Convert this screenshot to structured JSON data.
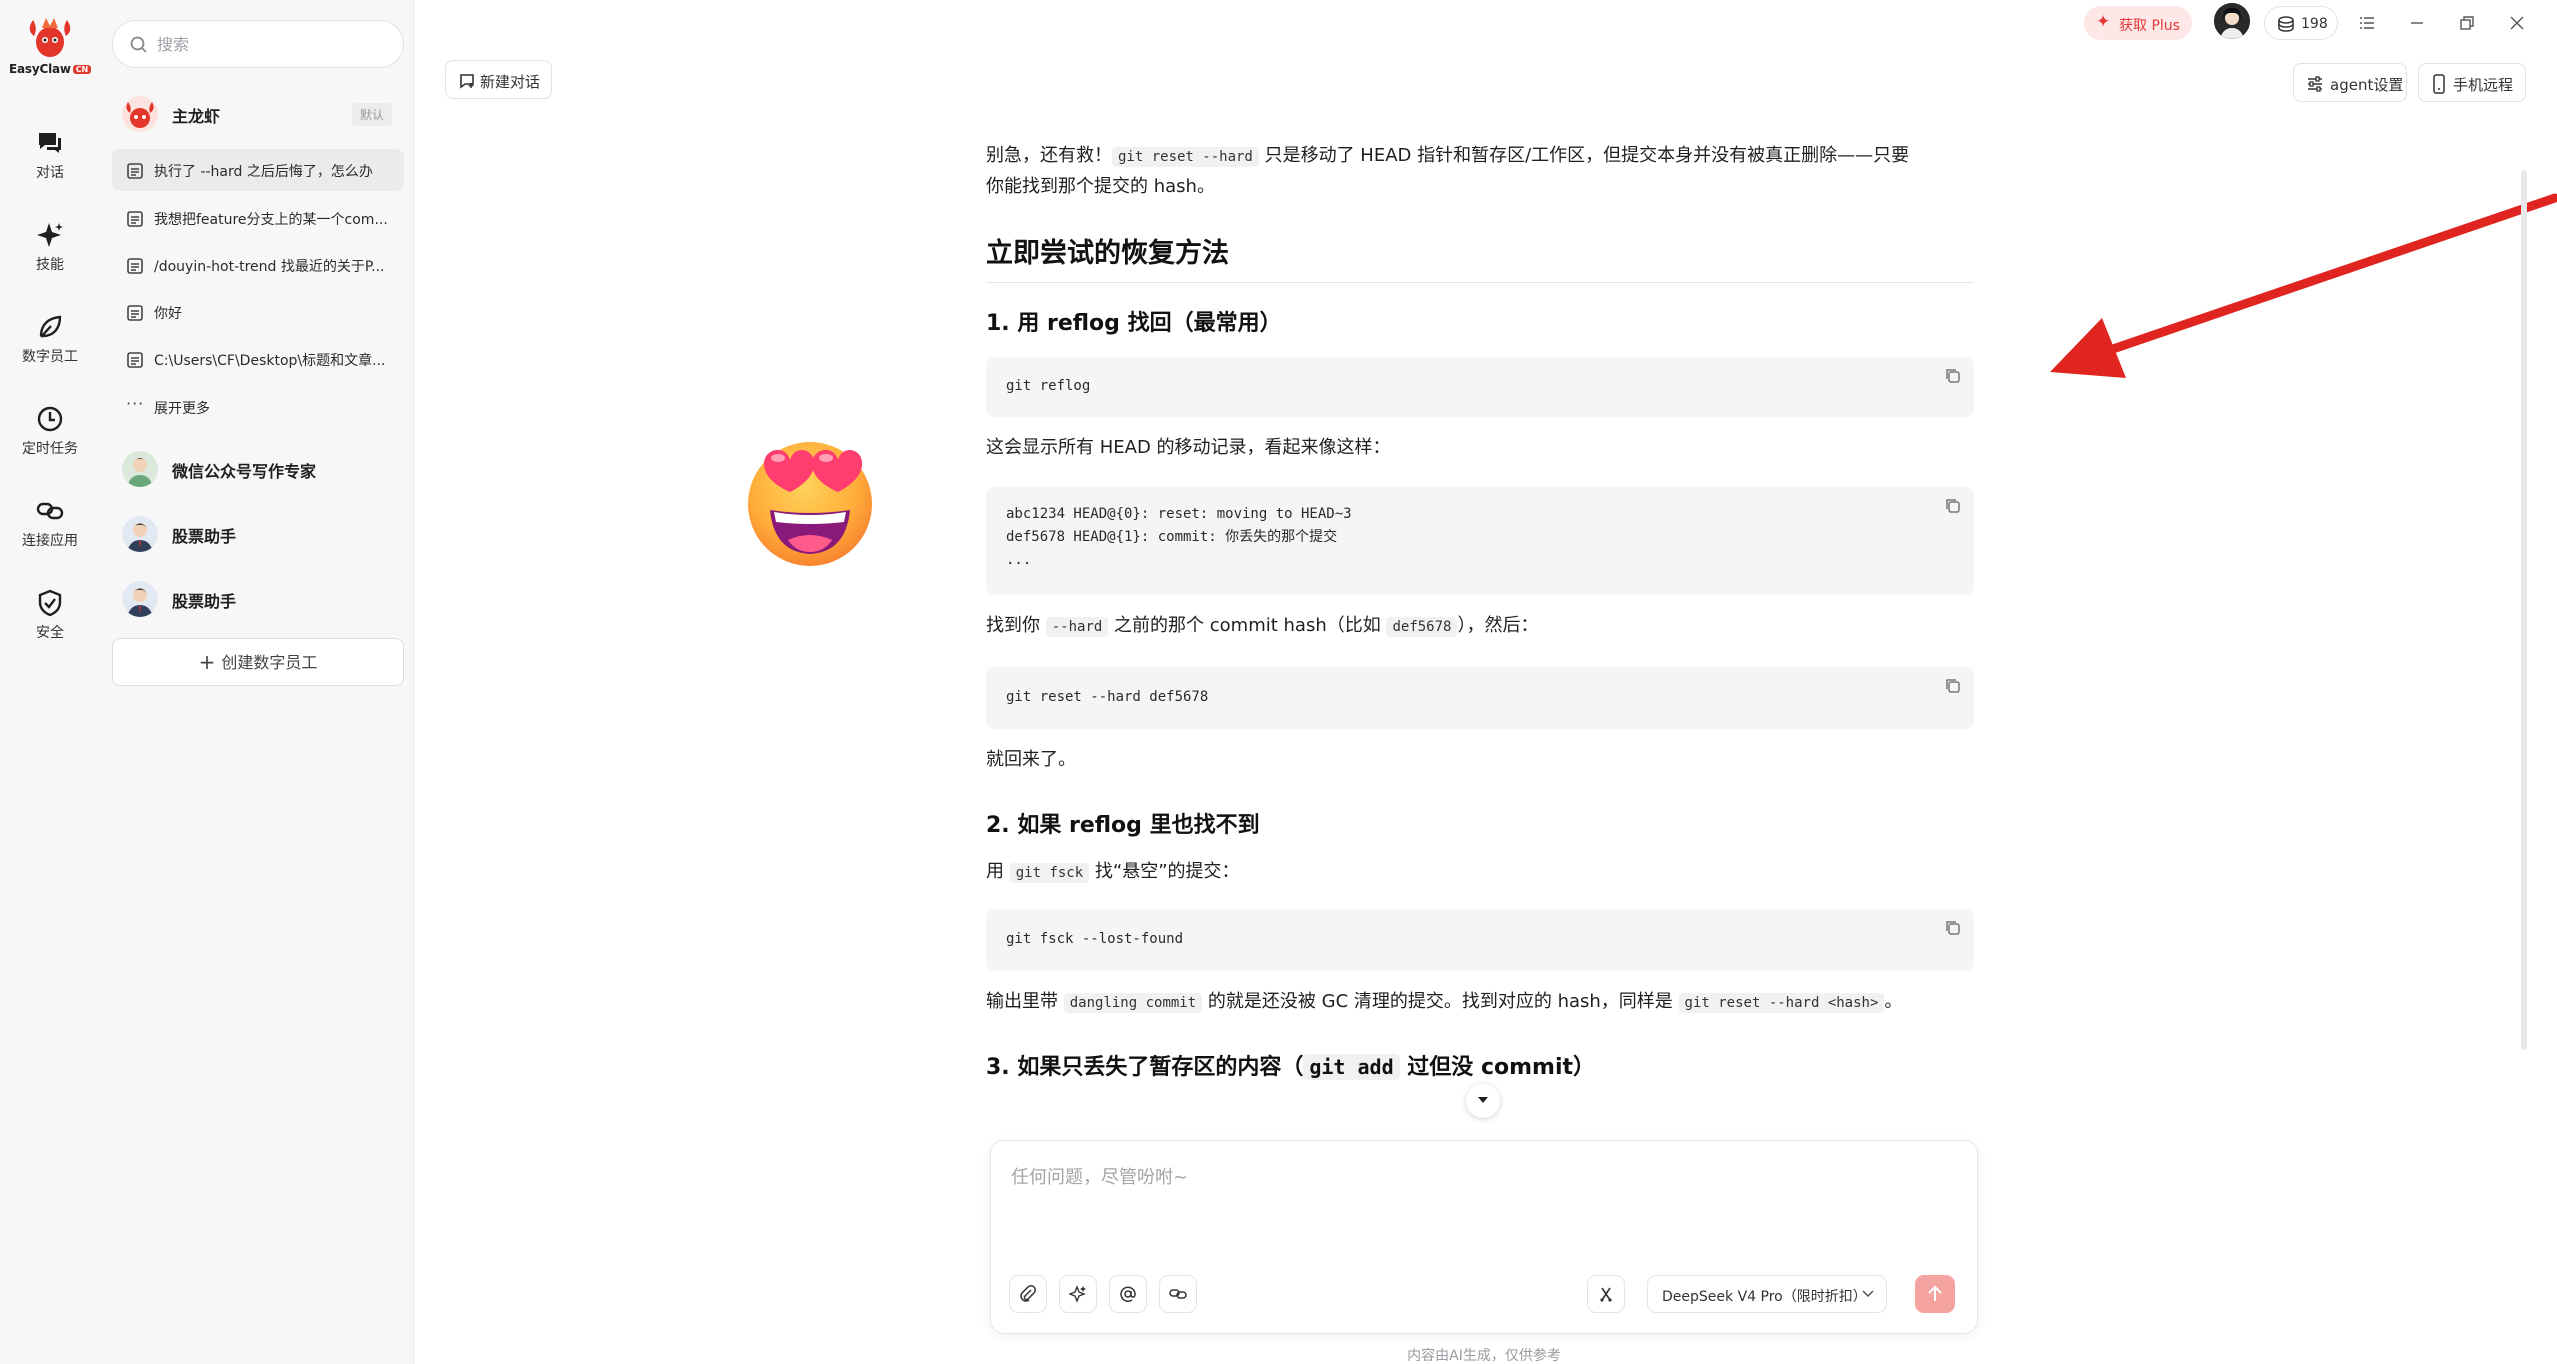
{
  "brand": {
    "name": "EasyClaw",
    "badge": "CN"
  },
  "rail": {
    "items": [
      {
        "label": "对话",
        "icon": "chat-icon"
      },
      {
        "label": "技能",
        "icon": "sparkle-icon"
      },
      {
        "label": "数字员工",
        "icon": "leaf-icon"
      },
      {
        "label": "定时任务",
        "icon": "clock-icon"
      },
      {
        "label": "连接应用",
        "icon": "link-icon"
      },
      {
        "label": "安全",
        "icon": "shield-icon"
      }
    ]
  },
  "sidebar": {
    "search_placeholder": "搜索",
    "main_agent": {
      "name": "主龙虾",
      "tag": "默认"
    },
    "conversations": [
      "执行了 --hard 之后后悔了，怎么办",
      "我想把feature分支上的某一个com...",
      "/douyin-hot-trend 找最近的关于P...",
      "你好",
      "C:\\Users\\CF\\Desktop\\标题和文章..."
    ],
    "expand_more": "展开更多",
    "agents": [
      {
        "name": "微信公众号写作专家"
      },
      {
        "name": "股票助手"
      },
      {
        "name": "股票助手"
      }
    ],
    "create_button": "创建数字员工"
  },
  "topbar": {
    "new_chat": "新建对话",
    "get_plus": "获取 Plus",
    "credits": "198",
    "agent_settings": "agent设置",
    "mobile_remote": "手机远程"
  },
  "message": {
    "intro_a": "别急，还有救！",
    "intro_code": "git reset --hard",
    "intro_b": " 只是移动了 HEAD 指针和暂存区/工作区，但提交本身并没有被真正删除——只要",
    "intro_c": "你能找到那个提交的 hash。",
    "heading": "立即尝试的恢复方法",
    "step1_title": "1. 用 reflog 找回（最常用）",
    "code1": "git reflog",
    "step1_text": "这会显示所有 HEAD 的移动记录，看起来像这样：",
    "code2": "abc1234 HEAD@{0}: reset: moving to HEAD~3\ndef5678 HEAD@{1}: commit: 你丢失的那个提交\n...",
    "find_a": "找到你 ",
    "find_code1": "--hard",
    "find_b": " 之前的那个 commit hash（比如 ",
    "find_code2": "def5678",
    "find_c": "），然后：",
    "code3": "git reset --hard def5678",
    "done_text": "就回来了。",
    "step2_title": "2. 如果 reflog 里也找不到",
    "fsck_a": "用 ",
    "fsck_code": "git fsck",
    "fsck_b": " 找“悬空”的提交：",
    "code4": "git fsck --lost-found",
    "dangling_a": "输出里带 ",
    "dangling_code": "dangling commit",
    "dangling_b": " 的就是还没被 GC 清理的提交。找到对应的 hash，同样是 ",
    "dangling_code2": "git reset --hard <hash>",
    "dangling_c": "。",
    "step3_a": "3. 如果只丢失了暂存区的内容（",
    "step3_code": "git add",
    "step3_b": " 过但没 commit）"
  },
  "composer": {
    "placeholder": "任何问题，尽管吩咐~",
    "model": "DeepSeek V4 Pro（限时折扣）",
    "disclaimer": "内容由AI生成，仅供参考"
  },
  "colors": {
    "accent_red": "#e53a3a",
    "send_button": "#f5a3a0",
    "arrow": "#e0241f"
  }
}
